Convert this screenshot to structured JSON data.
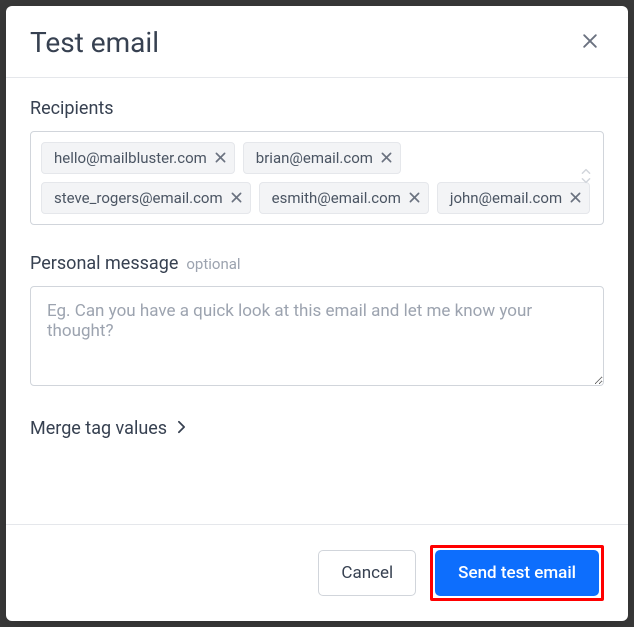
{
  "modal": {
    "title": "Test email"
  },
  "recipients": {
    "label": "Recipients",
    "chips": [
      "hello@mailbluster.com",
      "brian@email.com",
      "steve_rogers@email.com",
      "esmith@email.com",
      "john@email.com"
    ]
  },
  "personalMessage": {
    "label": "Personal message",
    "optional": "optional",
    "placeholder": "Eg. Can you have a quick look at this email and let me know your thought?",
    "value": ""
  },
  "mergeTags": {
    "label": "Merge tag values"
  },
  "footer": {
    "cancel": "Cancel",
    "send": "Send test email"
  }
}
